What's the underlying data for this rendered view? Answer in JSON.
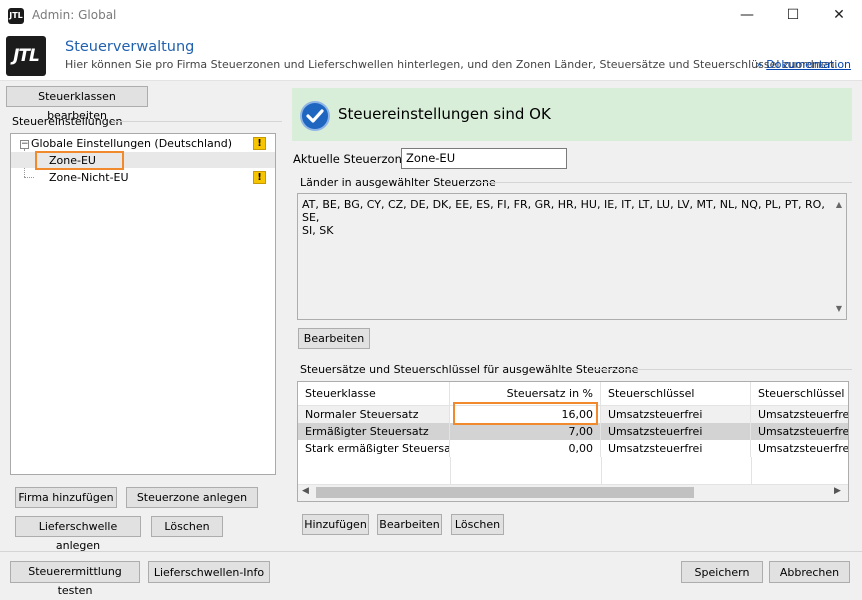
{
  "window": {
    "app_icon_text": "JTL",
    "title": "Admin: Global",
    "minimize": "—",
    "maximize": "☐",
    "close": "✕"
  },
  "header": {
    "logo_text": "JTL",
    "title": "Steuerverwaltung",
    "subtitle": "Hier können Sie pro Firma Steuerzonen und Lieferschwellen hinterlegen, und den Zonen Länder, Steuersätze und Steuerschlüssel zuordnen.",
    "doc_prefix": "»",
    "doc_link": "Dokumentation"
  },
  "left": {
    "tax_classes_button": "Steuerklassen bearbeiten",
    "group_label": "Steuereinstellungen",
    "tree": [
      {
        "label": "Globale Einstellungen (Deutschland)",
        "warning": "!"
      },
      {
        "label": "Zone-EU"
      },
      {
        "label": "Zone-Nicht-EU",
        "warning": "!"
      }
    ],
    "add_company_button": "Firma hinzufügen",
    "add_zone_button": "Steuerzone anlegen",
    "add_threshold_button": "Lieferschwelle anlegen",
    "delete_button": "Löschen"
  },
  "right": {
    "status_text": "Steuereinstellungen sind OK",
    "current_zone_label": "Aktuelle Steuerzone:",
    "current_zone_value": "Zone-EU",
    "countries_group_label": "Länder in ausgewählter Steuerzone",
    "countries_line1": "AT, BE, BG, CY, CZ, DE, DK, EE, ES, FI, FR, GR, HR, HU, IE, IT, LT, LU, LV, MT, NL, NQ, PL, PT, RO, SE,",
    "countries_line2": "SI, SK",
    "edit_countries_button": "Bearbeiten",
    "rates_group_label": "Steuersätze und Steuerschlüssel für ausgewählte Steuerzone",
    "table": {
      "columns": [
        "Steuerklasse",
        "Steuersatz in %",
        "Steuerschlüssel",
        "Steuerschlüssel steu"
      ],
      "rows": [
        [
          "Normaler Steuersatz",
          "16,00",
          "Umsatzsteuerfrei",
          "Umsatzsteuerfrei"
        ],
        [
          "Ermäßigter Steuersatz",
          "7,00",
          "Umsatzsteuerfrei",
          "Umsatzsteuerfrei"
        ],
        [
          "Stark ermäßigter Steuersatz",
          "0,00",
          "Umsatzsteuerfrei",
          "Umsatzsteuerfrei"
        ]
      ]
    },
    "add_button": "Hinzufügen",
    "edit_button": "Bearbeiten",
    "delete_button": "Löschen"
  },
  "bottom": {
    "test_button": "Steuerermittlung testen",
    "threshold_info_button": "Lieferschwellen-Info",
    "save_button": "Speichern",
    "cancel_button": "Abbrechen"
  },
  "colors": {
    "accent": "#2161ae",
    "highlight": "#f08a2c",
    "status_bg": "#d9eed9",
    "warning": "#f7c500"
  }
}
